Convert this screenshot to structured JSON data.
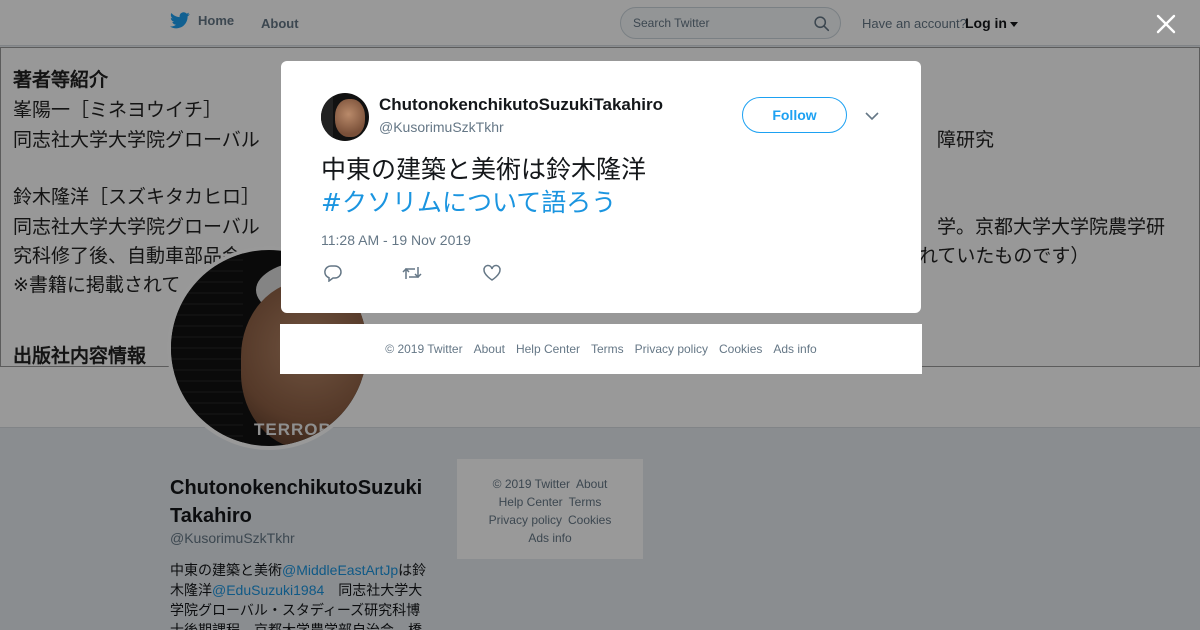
{
  "topnav": {
    "home_label": "Home",
    "about_label": "About",
    "search_placeholder": "Search Twitter",
    "account_prompt": "Have an account?",
    "login_label": "Log in"
  },
  "banner": {
    "lines": [
      "著者等紹介",
      "峯陽一［ミネヨウイチ］",
      "同志社大学大学院グローバル",
      "障研究",
      "鈴木隆洋［スズキタカヒロ］",
      "同志社大学大学院グローバル",
      "学。京都大学大学院農学研",
      "究科修了後、自動車部品会",
      "れていたものです）",
      "※書籍に掲載されて",
      "出版社内容情報"
    ],
    "avatar_caption": "TERRORI"
  },
  "profile": {
    "name": "ChutonokenchikutoSuzukiTakahiro",
    "handle": "@KusorimuSzkTkhr",
    "bio_p1": "中東の建築と美術",
    "bio_mention1": "@MiddleEastArtJp",
    "bio_p2": "は鈴木隆洋",
    "bio_mention2": "@EduSuzuki1984",
    "bio_p3": "　同志社大学大学院グローバル・スタディーズ研究科博士後期課程　京都大学農学部自治会　橋"
  },
  "side_footer": {
    "copyright": "© 2019 Twitter",
    "about": "About",
    "help": "Help Center",
    "terms": "Terms",
    "privacy": "Privacy policy",
    "cookies": "Cookies",
    "ads": "Ads info"
  },
  "tweet": {
    "author_name": "ChutonokenchikutoSuzukiTakahiro",
    "author_handle": "@KusorimuSzkTkhr",
    "follow_label": "Follow",
    "text": "中東の建築と美術は鈴木隆洋",
    "hashtag": "#クソリムについて語ろう",
    "timestamp": "11:28 AM - 19 Nov 2019",
    "actions": [
      "reply-icon",
      "retweet-icon",
      "like-icon"
    ]
  },
  "modal_footer": {
    "copyright": "© 2019 Twitter",
    "about": "About",
    "help": "Help Center",
    "terms": "Terms",
    "privacy": "Privacy policy",
    "cookies": "Cookies",
    "ads": "Ads info"
  },
  "colors": {
    "brand": "#1da1f2",
    "link": "#1b95e0",
    "muted": "#657786",
    "overlay": "rgba(0,0,0,0.4)"
  }
}
